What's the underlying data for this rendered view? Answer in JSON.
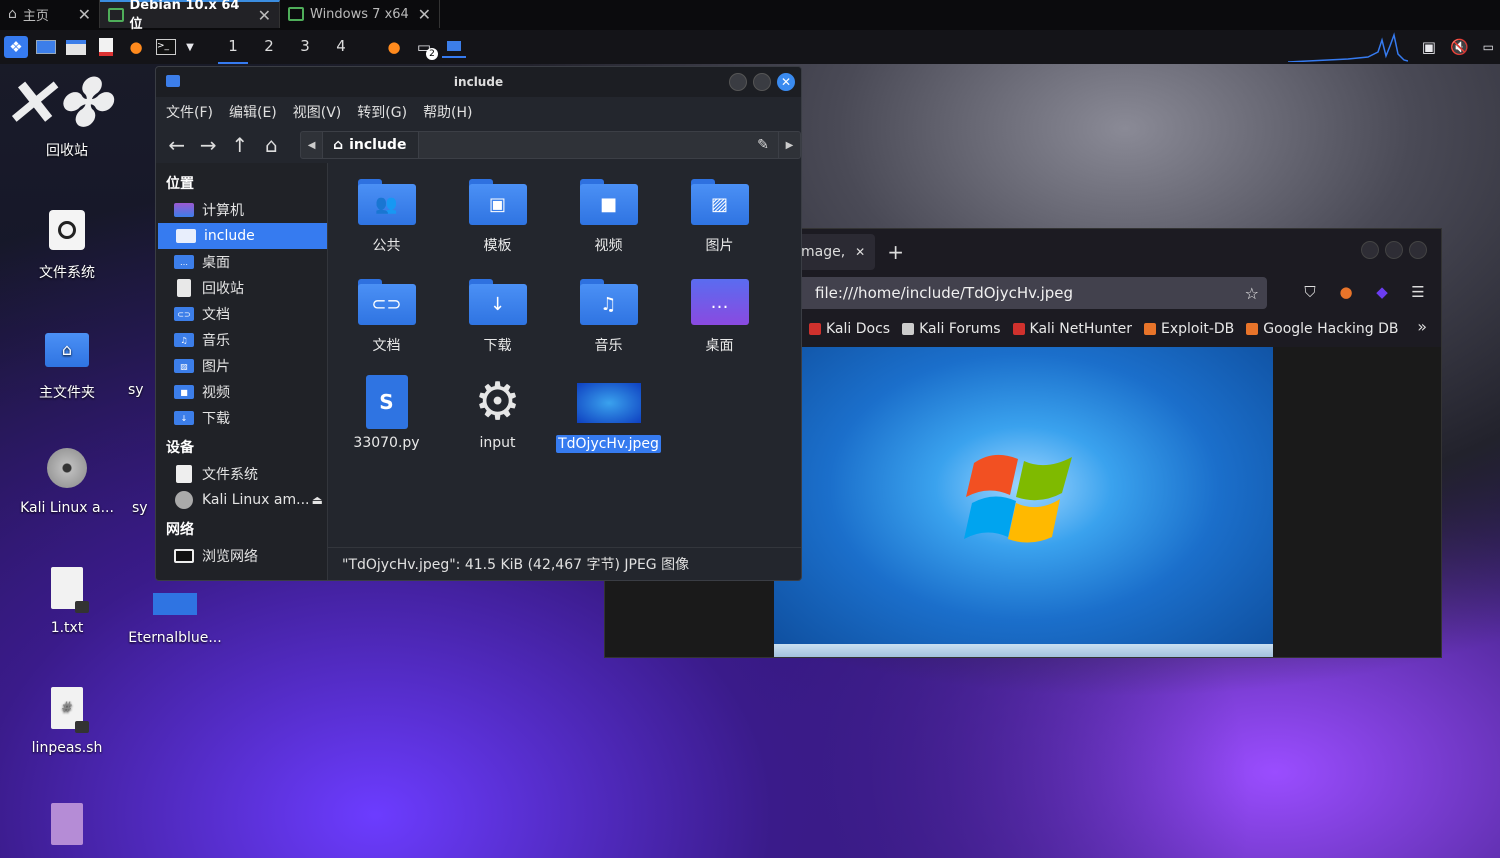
{
  "vm_tabs": [
    {
      "label": "主页",
      "active": false
    },
    {
      "label": "Debian 10.x 64 位",
      "active": true
    },
    {
      "label": "Windows 7 x64",
      "active": false
    }
  ],
  "panel": {
    "workspaces": [
      "1",
      "2",
      "3",
      "4"
    ],
    "active_workspace": "1",
    "badge_count": "2"
  },
  "desktop": {
    "icons": [
      {
        "label": "回收站",
        "icon": "trash-icon"
      },
      {
        "label": "文件系统",
        "icon": "drive-icon"
      },
      {
        "label": "主文件夹",
        "icon": "home-folder-icon"
      },
      {
        "label": "Kali Linux a...",
        "icon": "cd-icon"
      },
      {
        "label": "1.txt",
        "icon": "text-file-icon"
      },
      {
        "label": "linpeas.sh",
        "icon": "script-file-icon"
      },
      {
        "label": "Eternalblue...",
        "icon": "folder-icon"
      },
      {
        "label": "sy",
        "icon": "file-icon"
      },
      {
        "label": "sy",
        "icon": "file-icon"
      }
    ]
  },
  "file_manager": {
    "title": "include",
    "menu": [
      "文件(F)",
      "编辑(E)",
      "视图(V)",
      "转到(G)",
      "帮助(H)"
    ],
    "path": "include",
    "sidebar": {
      "places_header": "位置",
      "places": [
        {
          "label": "计算机",
          "icon": "computer-icon"
        },
        {
          "label": "include",
          "icon": "home-icon",
          "selected": true
        },
        {
          "label": "桌面",
          "icon": "desktop-icon"
        },
        {
          "label": "回收站",
          "icon": "trash-icon"
        },
        {
          "label": "文档",
          "icon": "documents-icon"
        },
        {
          "label": "音乐",
          "icon": "music-icon"
        },
        {
          "label": "图片",
          "icon": "pictures-icon"
        },
        {
          "label": "视频",
          "icon": "videos-icon"
        },
        {
          "label": "下载",
          "icon": "downloads-icon"
        }
      ],
      "devices_header": "设备",
      "devices": [
        {
          "label": "文件系统",
          "icon": "drive-icon"
        },
        {
          "label": "Kali Linux am...",
          "icon": "cd-icon"
        }
      ],
      "network_header": "网络",
      "network": [
        {
          "label": "浏览网络",
          "icon": "network-icon"
        }
      ]
    },
    "items": [
      {
        "label": "公共",
        "icon": "public-folder-icon",
        "glyph": "👥"
      },
      {
        "label": "模板",
        "icon": "templates-folder-icon",
        "glyph": "▣"
      },
      {
        "label": "视频",
        "icon": "videos-folder-icon",
        "glyph": "■"
      },
      {
        "label": "图片",
        "icon": "pictures-folder-icon",
        "glyph": "▨"
      },
      {
        "label": "文档",
        "icon": "documents-folder-icon",
        "glyph": "⊂⊃"
      },
      {
        "label": "下载",
        "icon": "downloads-folder-icon",
        "glyph": "↓"
      },
      {
        "label": "音乐",
        "icon": "music-folder-icon",
        "glyph": "♫"
      },
      {
        "label": "桌面",
        "icon": "desktop-folder-icon",
        "glyph": "…"
      },
      {
        "label": "33070.py",
        "icon": "python-file-icon"
      },
      {
        "label": "input",
        "icon": "gear-file-icon"
      },
      {
        "label": "TdOjycHv.jpeg",
        "icon": "image-file-icon",
        "selected": true
      }
    ],
    "status": "\"TdOjycHv.jpeg\": 41.5 KiB (42,467 字节) JPEG 图像"
  },
  "firefox": {
    "tab_title": "mage,",
    "url": "file:///home/include/TdOjycHv.jpeg",
    "bookmarks": [
      {
        "label": "Kali Docs",
        "color": "#d0312d"
      },
      {
        "label": "Kali Forums",
        "color": "#cccccc"
      },
      {
        "label": "Kali NetHunter",
        "color": "#d0312d"
      },
      {
        "label": "Exploit-DB",
        "color": "#e8742a"
      },
      {
        "label": "Google Hacking DB",
        "color": "#e8742a"
      }
    ]
  },
  "colors": {
    "accent": "#367bf0",
    "folder": "#3c82ee",
    "window_bg": "#23262d"
  }
}
